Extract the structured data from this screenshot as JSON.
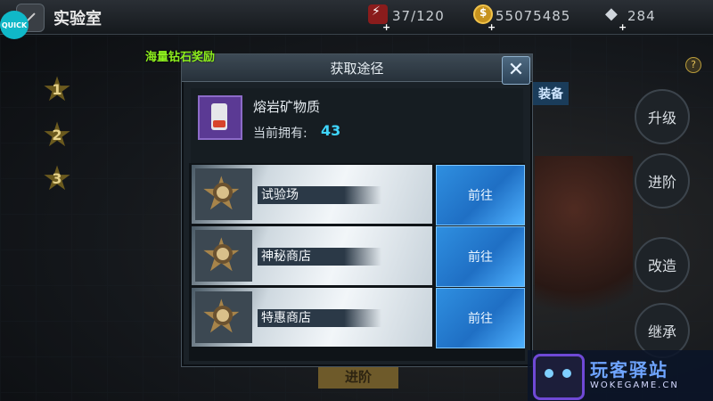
{
  "topbar": {
    "quick_label": "QUICK",
    "title": "实验室",
    "energy": "37/120",
    "coins": "55075485",
    "diamonds": "284"
  },
  "promo": "海量钻石奖励",
  "left_ranks": [
    "1",
    "2",
    "3"
  ],
  "right_menu": [
    "升级",
    "进阶",
    "改造",
    "继承"
  ],
  "background_tab": "装备",
  "background_advance_button": "进阶",
  "dialog": {
    "title": "获取途径",
    "item": {
      "name": "熔岩矿物质",
      "owned_label": "当前拥有:",
      "owned_value": "43"
    },
    "sources": [
      {
        "name": "试验场",
        "button": "前往"
      },
      {
        "name": "神秘商店",
        "button": "前往"
      },
      {
        "name": "特惠商店",
        "button": "前往"
      }
    ]
  },
  "watermark": {
    "title": "玩客驿站",
    "url": "WOKEGAME.CN"
  }
}
